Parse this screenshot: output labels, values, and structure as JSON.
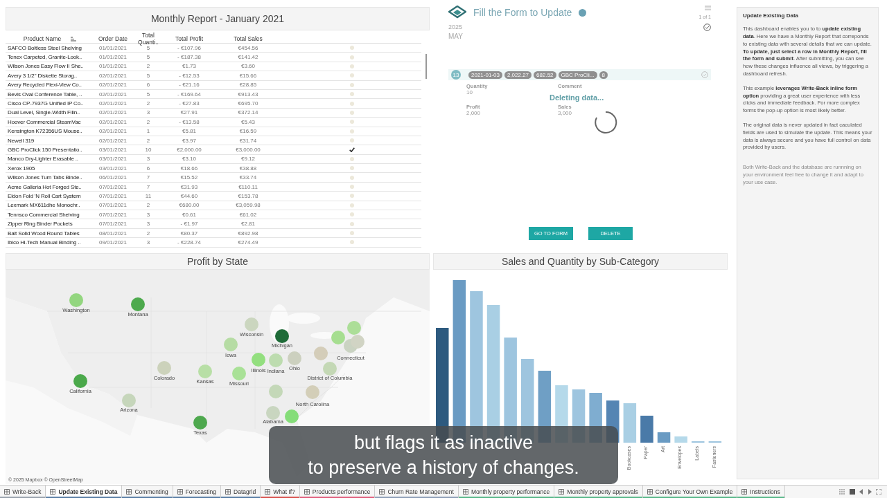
{
  "report": {
    "title": "Monthly Report  - January 2021",
    "columns": [
      "Product Name",
      "Order Date",
      "Total Quanti..",
      "Total Profit",
      "Total Sales"
    ],
    "rows": [
      {
        "name": "SAFCO Boltless Steel Shelving",
        "date": "01/01/2021",
        "qty": "5",
        "profit": "- €107.96",
        "sales": "€454.56",
        "checked": false
      },
      {
        "name": "Tenex Carpeted, Granite-Look..",
        "date": "01/01/2021",
        "qty": "5",
        "profit": "- €187.38",
        "sales": "€141.42",
        "checked": false
      },
      {
        "name": "Wilson Jones Easy Flow II She..",
        "date": "01/01/2021",
        "qty": "2",
        "profit": "€1.73",
        "sales": "€3.60",
        "checked": false
      },
      {
        "name": "Avery 3 1/2\" Diskette Storag..",
        "date": "02/01/2021",
        "qty": "5",
        "profit": "- €12.53",
        "sales": "€15.66",
        "checked": false
      },
      {
        "name": "Avery Recycled Flexi-View Co..",
        "date": "02/01/2021",
        "qty": "6",
        "profit": "- €21.16",
        "sales": "€28.85",
        "checked": false
      },
      {
        "name": "Bevis Oval Conference Table, ..",
        "date": "02/01/2021",
        "qty": "5",
        "profit": "- €169.64",
        "sales": "€913.43",
        "checked": false
      },
      {
        "name": "Cisco CP-7937G Unified IP Co..",
        "date": "02/01/2021",
        "qty": "2",
        "profit": "- €27.83",
        "sales": "€695.70",
        "checked": false
      },
      {
        "name": "Dual Level, Single-Width Filin..",
        "date": "02/01/2021",
        "qty": "3",
        "profit": "€27.91",
        "sales": "€372.14",
        "checked": false
      },
      {
        "name": "Hoover Commercial SteamVac",
        "date": "02/01/2021",
        "qty": "2",
        "profit": "- €13.58",
        "sales": "€5.43",
        "checked": false
      },
      {
        "name": "Kensington K72356US Mouse..",
        "date": "02/01/2021",
        "qty": "1",
        "profit": "€5.81",
        "sales": "€16.59",
        "checked": false
      },
      {
        "name": "Newell 319",
        "date": "02/01/2021",
        "qty": "2",
        "profit": "€3.97",
        "sales": "€31.74",
        "checked": false
      },
      {
        "name": "GBC ProClick 150 Presentatio..",
        "date": "03/01/2021",
        "qty": "10",
        "profit": "€2,000.00",
        "sales": "€3,000.00",
        "checked": true
      },
      {
        "name": "Manco Dry-Lighter Erasable ..",
        "date": "03/01/2021",
        "qty": "3",
        "profit": "€3.10",
        "sales": "€9.12",
        "checked": false
      },
      {
        "name": "Xerox 1905",
        "date": "03/01/2021",
        "qty": "6",
        "profit": "€18.66",
        "sales": "€38.88",
        "checked": false
      },
      {
        "name": "Wilson Jones Turn Tabs Binde..",
        "date": "06/01/2021",
        "qty": "7",
        "profit": "€15.52",
        "sales": "€33.74",
        "checked": false
      },
      {
        "name": "Acme Galleria Hot Forged Ste..",
        "date": "07/01/2021",
        "qty": "7",
        "profit": "€31.93",
        "sales": "€110.11",
        "checked": false
      },
      {
        "name": "Eldon Fold 'N Roll Cart System",
        "date": "07/01/2021",
        "qty": "11",
        "profit": "€44.60",
        "sales": "€153.78",
        "checked": false
      },
      {
        "name": "Lexmark MX611dhe Monochr..",
        "date": "07/01/2021",
        "qty": "2",
        "profit": "€680.00",
        "sales": "€3,059.98",
        "checked": false
      },
      {
        "name": "Tennsco Commercial Shelving",
        "date": "07/01/2021",
        "qty": "3",
        "profit": "€0.61",
        "sales": "€61.02",
        "checked": false
      },
      {
        "name": "Zipper Ring Binder Pockets",
        "date": "07/01/2021",
        "qty": "3",
        "profit": "- €1.97",
        "sales": "€2.81",
        "checked": false
      },
      {
        "name": "Balt Solid Wood Round Tables",
        "date": "08/01/2021",
        "qty": "2",
        "profit": "€80.37",
        "sales": "€892.98",
        "checked": false
      },
      {
        "name": "Ibico Hi-Tech Manual Binding ..",
        "date": "09/01/2021",
        "qty": "3",
        "profit": "- €228.74",
        "sales": "€274.49",
        "checked": false
      }
    ]
  },
  "form": {
    "title": "Fill the Form to Update",
    "pager": "1 of 1",
    "year": "2025",
    "month": "MAY",
    "day": "13",
    "chips": [
      "2021-01-03",
      "2,022.27",
      "682.52",
      "GBC ProCli...",
      "8"
    ],
    "fields": [
      {
        "label": "Quantity",
        "value": "10"
      },
      {
        "label": "Comment"
      },
      {
        "label": "Profit",
        "value": "2,000"
      },
      {
        "label": "Sales",
        "value": "3,000"
      }
    ],
    "status": "Deleting data...",
    "buttons": [
      "GO TO FORM",
      "DELETE"
    ]
  },
  "map": {
    "title": "Profit by State",
    "credit": "© 2025 Mapbox © OpenStreetMap",
    "states": [
      {
        "label": "Washington",
        "color": "#93d67f"
      },
      {
        "label": "Montana",
        "color": "#4eaa4e"
      },
      {
        "label": "Wisconsin",
        "color": "#cbd6bf"
      },
      {
        "label": "Michigan",
        "color": "#1f6b38"
      },
      {
        "label": "Iowa",
        "color": "#b6dca4"
      },
      {
        "label": "Illinois",
        "color": "#93df7f"
      },
      {
        "label": "Indiana",
        "color": "#bddcaf"
      },
      {
        "label": "Ohio",
        "color": "#ccd0bf"
      },
      {
        "label": "Colorado",
        "color": "#ccd2bb"
      },
      {
        "label": "Kansas",
        "color": "#b8dfa6"
      },
      {
        "label": "Missouri",
        "color": "#a9e197"
      },
      {
        "label": "California",
        "color": "#4ba94b"
      },
      {
        "label": "Arizona",
        "color": "#c6d6bb"
      },
      {
        "label": "Texas",
        "color": "#4ea84e"
      },
      {
        "label": "Connecticut",
        "color": "#cad3c2"
      },
      {
        "color": "#acde98"
      },
      {
        "color": "#a6de90"
      },
      {
        "color": "#d1d4c4"
      },
      {
        "color": "#d4cdb9"
      },
      {
        "label": "District of Columbia",
        "color": "#c4d8b5"
      },
      {
        "color": "#c4d8b8"
      },
      {
        "label": "North Carolina",
        "color": "#d3ceb8"
      },
      {
        "label": "Alabama",
        "color": "#c9d6c0"
      },
      {
        "color": "#85dd79"
      }
    ]
  },
  "chart": {
    "title": "Sales and Quantity by Sub-Category",
    "axis_labels": [
      "Bookcases",
      "Paper",
      "Art",
      "Envelopes",
      "Labels",
      "Fasteners"
    ]
  },
  "sidebar": {
    "title": "Update Existing Data",
    "paragraphs": [
      {
        "text": "This dashboard enables you to to **update existing data**. Here we have a Monthly Report that correponds to existing data with several details that we can update. **To update, just select a row in Monthly Report, fill the form and submit**. After submitting, you can see how these changes influence all views, by triggering a dashboard refresh.",
        "muted": false
      },
      {
        "text": "This example **leverages Write-Back inline form option** providing a great user experience with less clicks and immediate feedback. For more complex forms the pop-up option is most likely better.",
        "muted": false
      },
      {
        "text": "The original data is never updated in fact caculated fields are used to simulate the update. This means your data is always secure and you have full control on data provided by users.",
        "muted": false
      },
      {
        "text": "Both Write-Back and the database are runnning on your environment feel free to change it and adapt to your use case.",
        "muted": true
      }
    ]
  },
  "caption": [
    "but flags it as inactive",
    "to preserve a history of changes."
  ],
  "tabs": [
    {
      "label": "Write-Back",
      "selected": false,
      "color": "#9aa3ad"
    },
    {
      "label": "Update Existing Data",
      "selected": true,
      "color": "#5b7fa6"
    },
    {
      "label": "Commenting",
      "selected": false,
      "color": "#5b7fa6"
    },
    {
      "label": "Forecasting",
      "selected": false,
      "color": "#5b7fa6"
    },
    {
      "label": "Datagrid",
      "selected": false,
      "color": "#5b7fa6"
    },
    {
      "label": "What If?",
      "selected": false,
      "color": "#d9534f"
    },
    {
      "label": "Products performance",
      "selected": false,
      "color": "#e0607e"
    },
    {
      "label": "Churn Rate Management",
      "selected": false,
      "color": "#8fa0b8"
    },
    {
      "label": "Monthly property performance",
      "selected": false,
      "color": "#59b88a"
    },
    {
      "label": "Monthly property approvals",
      "selected": false,
      "color": "#59b88a"
    },
    {
      "label": "Configure Your Own Example",
      "selected": false,
      "color": "#59b88a"
    },
    {
      "label": "Instructions",
      "selected": false,
      "color": "#59b88a"
    }
  ]
}
